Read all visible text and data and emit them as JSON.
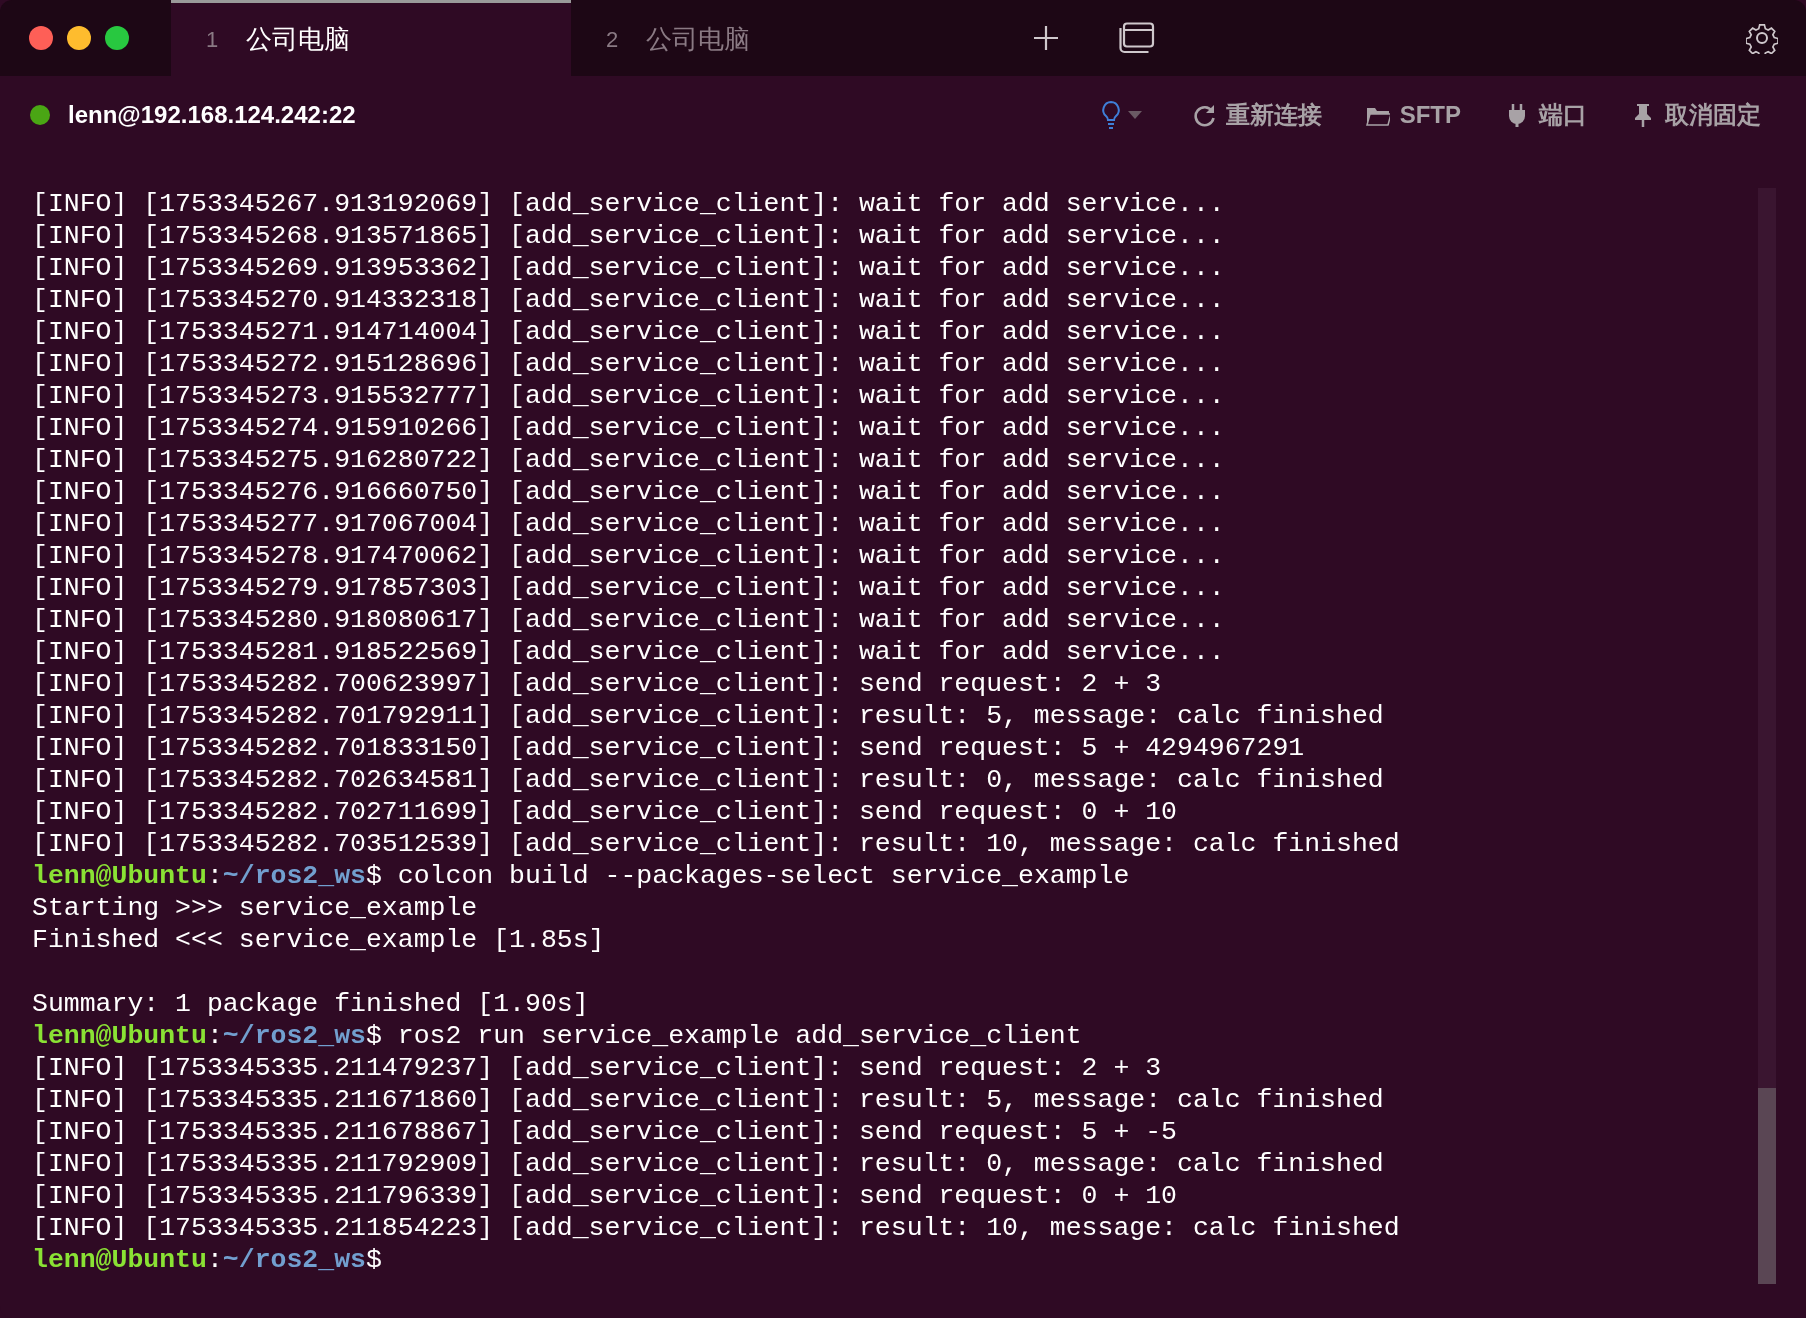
{
  "window": {
    "controls": [
      {
        "kind": "close"
      },
      {
        "kind": "minimize"
      },
      {
        "kind": "zoom"
      }
    ]
  },
  "tabs": [
    {
      "number": "1",
      "label": "公司电脑",
      "selected": true
    },
    {
      "number": "2",
      "label": "公司电脑",
      "selected": false
    }
  ],
  "session": {
    "connected": true,
    "address": "lenn@192.168.124.242:22"
  },
  "actions": [
    {
      "kind": "reconnect",
      "label": "重新连接"
    },
    {
      "kind": "sftp",
      "label": "SFTP"
    },
    {
      "kind": "port",
      "label": "端口"
    },
    {
      "kind": "unpin",
      "label": "取消固定"
    }
  ],
  "terminal": {
    "lines": [
      {
        "kind": "output",
        "text": "[INFO] [1753345267.913192069] [add_service_client]: wait for add service..."
      },
      {
        "kind": "output",
        "text": "[INFO] [1753345268.913571865] [add_service_client]: wait for add service..."
      },
      {
        "kind": "output",
        "text": "[INFO] [1753345269.913953362] [add_service_client]: wait for add service..."
      },
      {
        "kind": "output",
        "text": "[INFO] [1753345270.914332318] [add_service_client]: wait for add service..."
      },
      {
        "kind": "output",
        "text": "[INFO] [1753345271.914714004] [add_service_client]: wait for add service..."
      },
      {
        "kind": "output",
        "text": "[INFO] [1753345272.915128696] [add_service_client]: wait for add service..."
      },
      {
        "kind": "output",
        "text": "[INFO] [1753345273.915532777] [add_service_client]: wait for add service..."
      },
      {
        "kind": "output",
        "text": "[INFO] [1753345274.915910266] [add_service_client]: wait for add service..."
      },
      {
        "kind": "output",
        "text": "[INFO] [1753345275.916280722] [add_service_client]: wait for add service..."
      },
      {
        "kind": "output",
        "text": "[INFO] [1753345276.916660750] [add_service_client]: wait for add service..."
      },
      {
        "kind": "output",
        "text": "[INFO] [1753345277.917067004] [add_service_client]: wait for add service..."
      },
      {
        "kind": "output",
        "text": "[INFO] [1753345278.917470062] [add_service_client]: wait for add service..."
      },
      {
        "kind": "output",
        "text": "[INFO] [1753345279.917857303] [add_service_client]: wait for add service..."
      },
      {
        "kind": "output",
        "text": "[INFO] [1753345280.918080617] [add_service_client]: wait for add service..."
      },
      {
        "kind": "output",
        "text": "[INFO] [1753345281.918522569] [add_service_client]: wait for add service..."
      },
      {
        "kind": "output",
        "text": "[INFO] [1753345282.700623997] [add_service_client]: send request: 2 + 3"
      },
      {
        "kind": "output",
        "text": "[INFO] [1753345282.701792911] [add_service_client]: result: 5, message: calc finished"
      },
      {
        "kind": "output",
        "text": "[INFO] [1753345282.701833150] [add_service_client]: send request: 5 + 4294967291"
      },
      {
        "kind": "output",
        "text": "[INFO] [1753345282.702634581] [add_service_client]: result: 0, message: calc finished"
      },
      {
        "kind": "output",
        "text": "[INFO] [1753345282.702711699] [add_service_client]: send request: 0 + 10"
      },
      {
        "kind": "output",
        "text": "[INFO] [1753345282.703512539] [add_service_client]: result: 10, message: calc finished"
      },
      {
        "kind": "prompt",
        "user": "lenn@Ubuntu",
        "separator": ":",
        "path": "~/ros2_ws",
        "symbol": "$",
        "command": "colcon build --packages-select service_example"
      },
      {
        "kind": "output",
        "text": "Starting >>> service_example"
      },
      {
        "kind": "output",
        "text": "Finished <<< service_example [1.85s]"
      },
      {
        "kind": "blank"
      },
      {
        "kind": "output",
        "text": "Summary: 1 package finished [1.90s]"
      },
      {
        "kind": "prompt",
        "user": "lenn@Ubuntu",
        "separator": ":",
        "path": "~/ros2_ws",
        "symbol": "$",
        "command": "ros2 run service_example add_service_client"
      },
      {
        "kind": "output",
        "text": "[INFO] [1753345335.211479237] [add_service_client]: send request: 2 + 3"
      },
      {
        "kind": "output",
        "text": "[INFO] [1753345335.211671860] [add_service_client]: result: 5, message: calc finished"
      },
      {
        "kind": "output",
        "text": "[INFO] [1753345335.211678867] [add_service_client]: send request: 5 + -5"
      },
      {
        "kind": "output",
        "text": "[INFO] [1753345335.211792909] [add_service_client]: result: 0, message: calc finished"
      },
      {
        "kind": "output",
        "text": "[INFO] [1753345335.211796339] [add_service_client]: send request: 0 + 10"
      },
      {
        "kind": "output",
        "text": "[INFO] [1753345335.211854223] [add_service_client]: result: 10, message: calc finished"
      },
      {
        "kind": "prompt",
        "user": "lenn@Ubuntu",
        "separator": ":",
        "path": "~/ros2_ws",
        "symbol": "$"
      }
    ]
  }
}
